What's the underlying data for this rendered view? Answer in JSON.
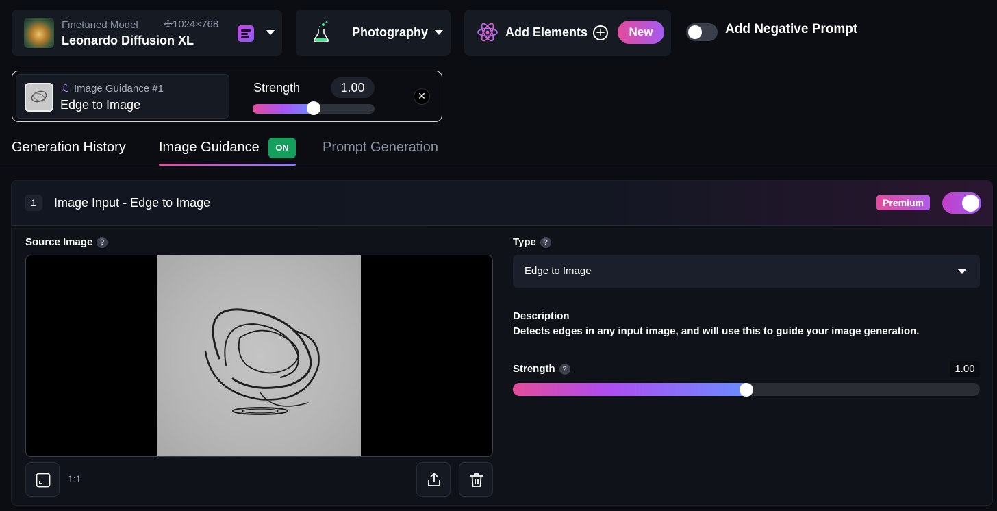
{
  "model": {
    "subtitle": "Finetuned Model",
    "dimensions": "1024×768",
    "name": "Leonardo Diffusion XL"
  },
  "style": {
    "label": "Photography"
  },
  "elements": {
    "label": "Add Elements",
    "new_badge": "New"
  },
  "negative_prompt": {
    "label": "Add Negative Prompt",
    "enabled": false
  },
  "guidance_chip": {
    "subtitle": "Image Guidance #1",
    "name": "Edge to Image",
    "strength_label": "Strength",
    "strength_value": "1.00",
    "slider_fraction": 0.5
  },
  "tabs": [
    {
      "label": "Generation History"
    },
    {
      "label": "Image Guidance",
      "badge": "ON",
      "active": true
    },
    {
      "label": "Prompt Generation"
    }
  ],
  "panel": {
    "step": "1",
    "title": "Image Input - Edge to Image",
    "premium_label": "Premium",
    "enabled": true,
    "source_label": "Source Image",
    "help_glyph": "?",
    "ratio": "1:1",
    "type_label": "Type",
    "type_value": "Edge to Image",
    "description_label": "Description",
    "description": "Detects edges in any input image, and will use this to guide your image generation.",
    "strength_label": "Strength",
    "strength_value": "1.00",
    "slider_fraction": 0.5
  },
  "colors": {
    "accent_start": "#e34c9b",
    "accent_end": "#6a8cff",
    "on_badge": "#12a05c",
    "background": "#0b0d12"
  }
}
